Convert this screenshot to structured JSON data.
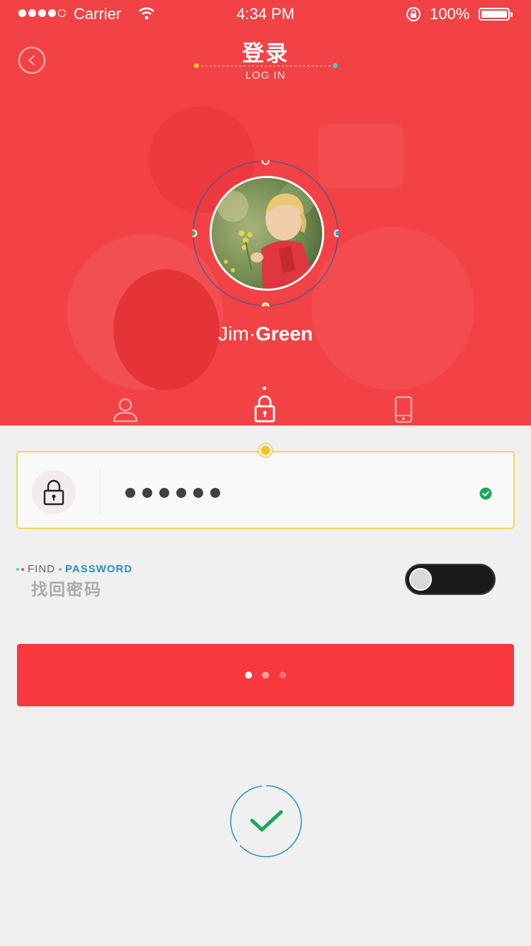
{
  "status_bar": {
    "carrier": "Carrier",
    "time": "4:34 PM",
    "battery": "100%"
  },
  "header": {
    "title": "登录",
    "subtitle": "LOG IN"
  },
  "profile": {
    "first_name": "Jim",
    "last_name": "Green"
  },
  "tabs": [
    {
      "icon": "user-icon",
      "active": false
    },
    {
      "icon": "lock-icon",
      "active": true
    },
    {
      "icon": "phone-icon",
      "active": false
    }
  ],
  "password_field": {
    "icon": "lock-icon",
    "masked_length": 6,
    "valid": true
  },
  "find_password": {
    "en_word1": "FIND",
    "en_word2": "PASSWORD",
    "cn_label": "找回密码"
  },
  "toggle": {
    "on": false
  },
  "colors": {
    "primary_red": "#f24245",
    "button_red": "#f7383c",
    "accent_yellow": "#f5c527",
    "accent_blue": "#2a8fc0",
    "accent_green": "#1aa858"
  }
}
